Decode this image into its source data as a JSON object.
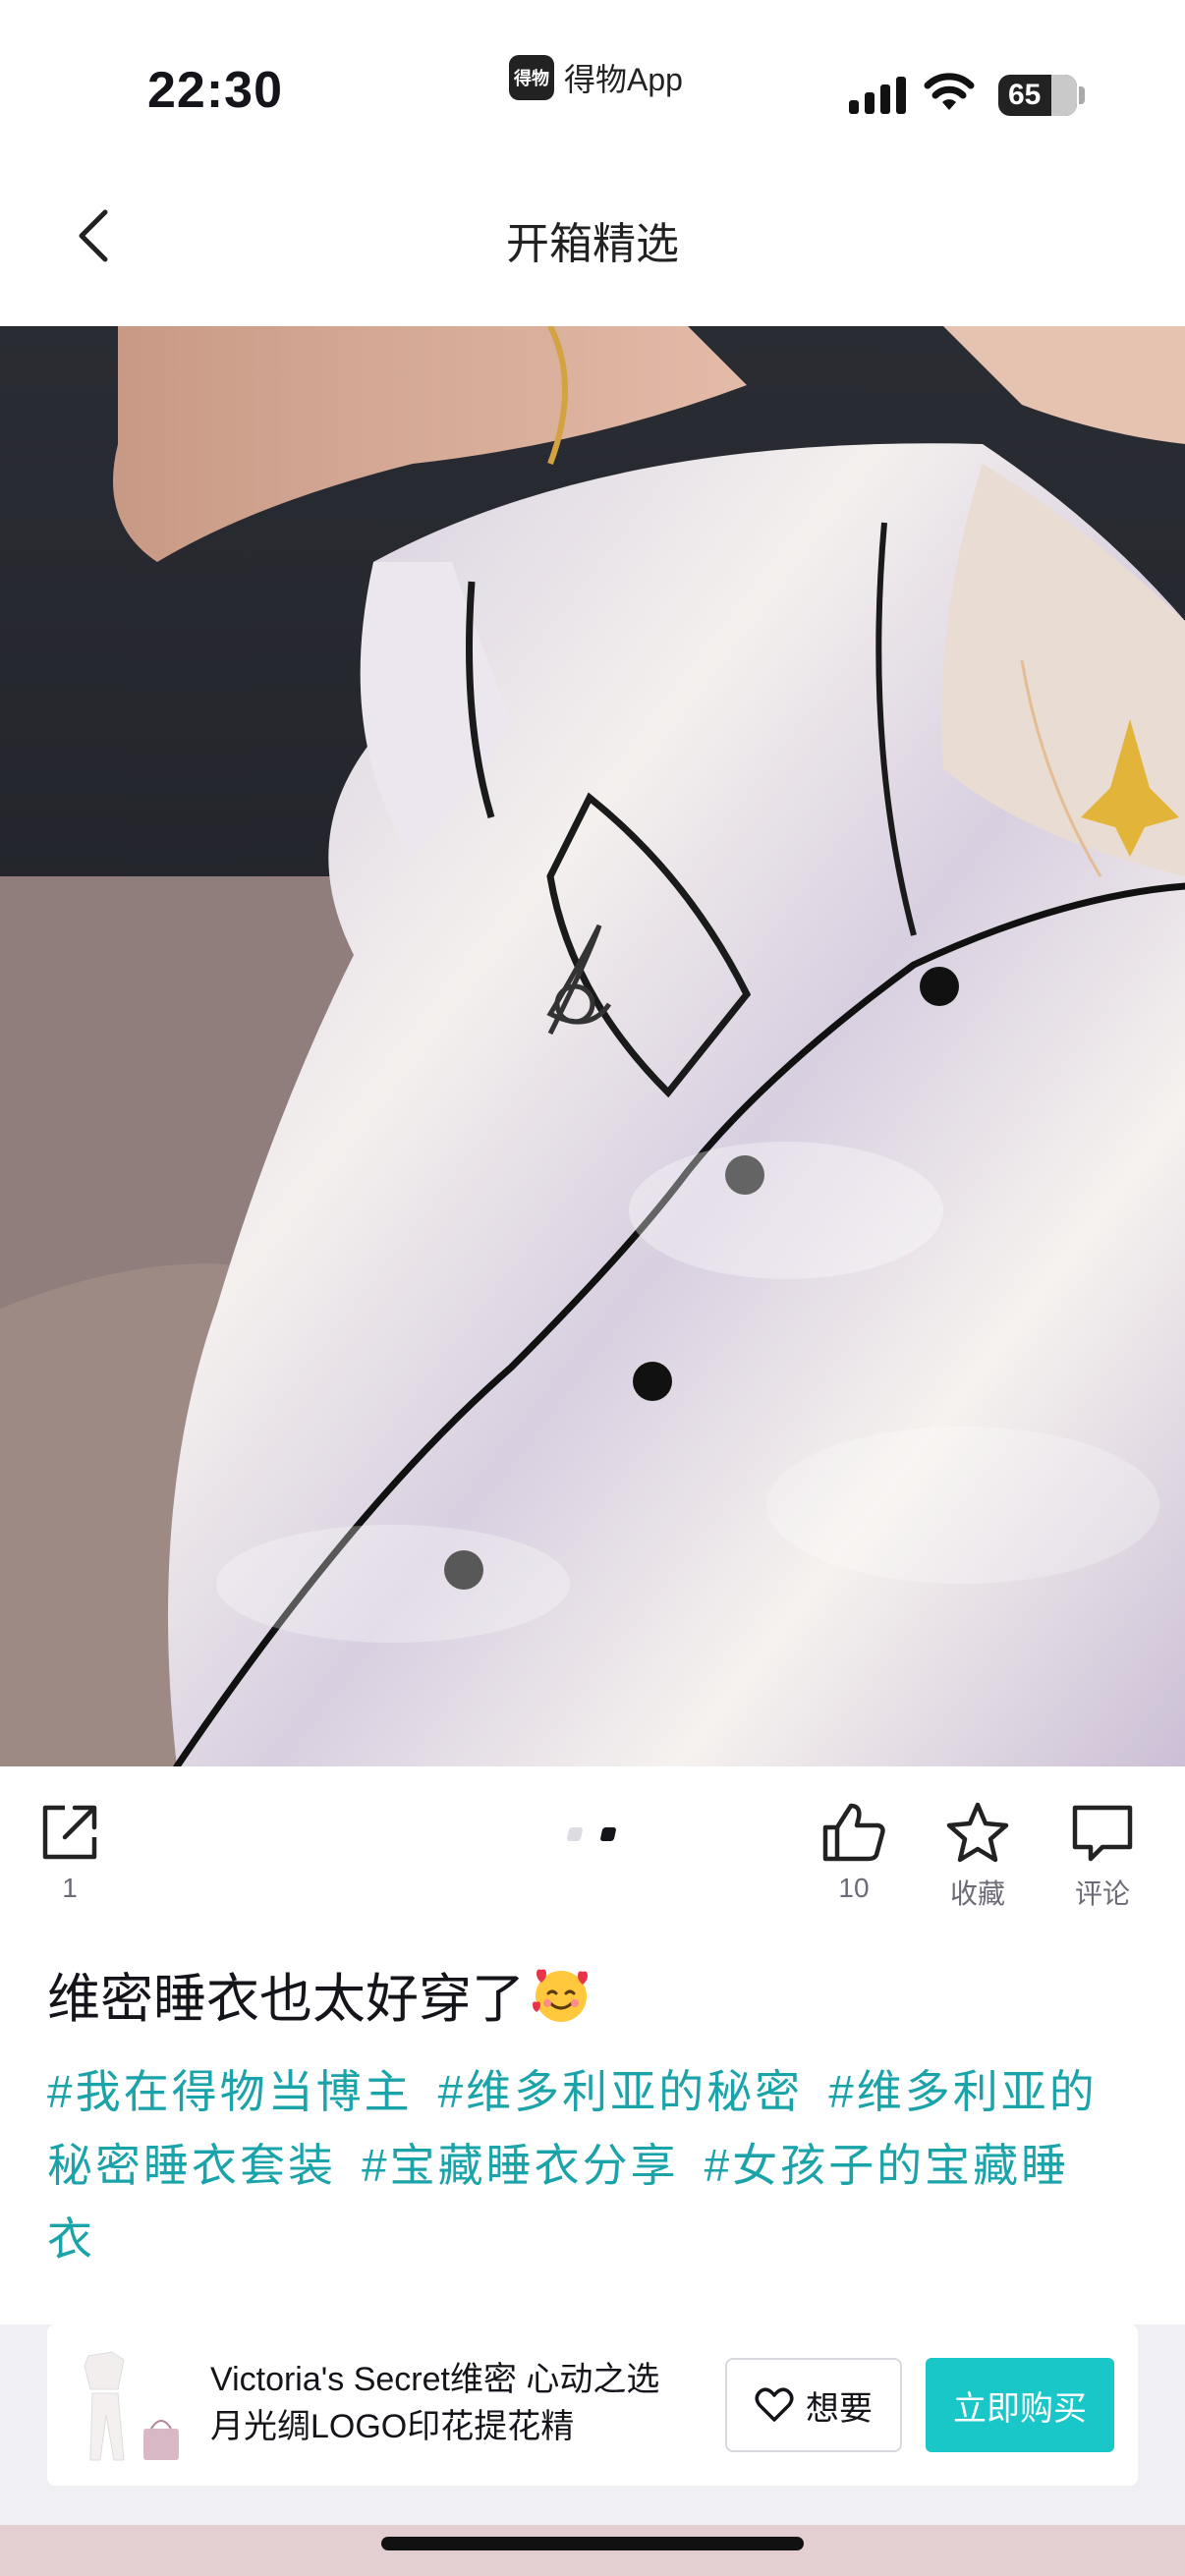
{
  "status_bar": {
    "time": "22:30",
    "carrier_logo": "得物",
    "carrier_app": "得物App",
    "battery": "65"
  },
  "nav": {
    "title": "开箱精选",
    "back_icon": "chevron-left-icon"
  },
  "photo": {
    "alt": "satin pajama photo",
    "page_count": 2,
    "active_page": 2
  },
  "actions": {
    "share": {
      "icon": "share-icon",
      "label": "1"
    },
    "like": {
      "icon": "thumbs-up-icon",
      "label": "10"
    },
    "favorite": {
      "icon": "star-icon",
      "label": "收藏"
    },
    "comment": {
      "icon": "comment-icon",
      "label": "评论"
    }
  },
  "post": {
    "title": "维密睡衣也太好穿了",
    "title_emoji": "smiling-face-with-hearts",
    "tags": [
      "#我在得物当博主",
      "#维多利亚的秘密",
      "#维多利亚的秘密睡衣套装",
      "#宝藏睡衣分享",
      "#女孩子的宝藏睡衣"
    ]
  },
  "product": {
    "name": "Victoria's Secret维密 心动之选 月光绸LOGO印花提花精",
    "want_label": "想要",
    "buy_label": "立即购买"
  },
  "colors": {
    "tag": "#1aa3a8",
    "buy_button": "#19c6c8"
  }
}
